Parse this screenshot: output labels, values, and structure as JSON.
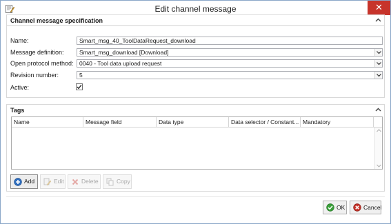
{
  "window": {
    "title": "Edit channel message",
    "close_glyph": "✕"
  },
  "spec_section": {
    "title": "Channel message specification",
    "fields": [
      {
        "label": "Name:",
        "value": "Smart_msg_40_ToolDataRequest_download",
        "type": "text"
      },
      {
        "label": "Message definition:",
        "value": "Smart_msg_download [Download]",
        "type": "dropdown"
      },
      {
        "label": "Open protocol method:",
        "value": "0040 - Tool data upload request",
        "type": "dropdown"
      },
      {
        "label": "Revision number:",
        "value": "5",
        "type": "dropdown"
      }
    ],
    "active": {
      "label": "Active:",
      "checked": true,
      "glyph": "✓"
    }
  },
  "tags_section": {
    "title": "Tags",
    "columns": [
      "Name",
      "Message field",
      "Data type",
      "Data selector / Constant...",
      "Mandatory"
    ],
    "rows": [],
    "buttons": [
      {
        "label": "Add",
        "icon": "add-icon",
        "enabled": true
      },
      {
        "label": "Edit",
        "icon": "edit-icon",
        "enabled": false
      },
      {
        "label": "Delete",
        "icon": "delete-icon",
        "enabled": false
      },
      {
        "label": "Copy",
        "icon": "copy-icon",
        "enabled": false
      }
    ]
  },
  "footer": {
    "ok_label": "OK",
    "cancel_label": "Cancel"
  },
  "colors": {
    "close": "#c7342b",
    "ok_icon": "#3aa13a",
    "cancel_icon": "#c7342b",
    "add_icon": "#2f6fc0"
  }
}
